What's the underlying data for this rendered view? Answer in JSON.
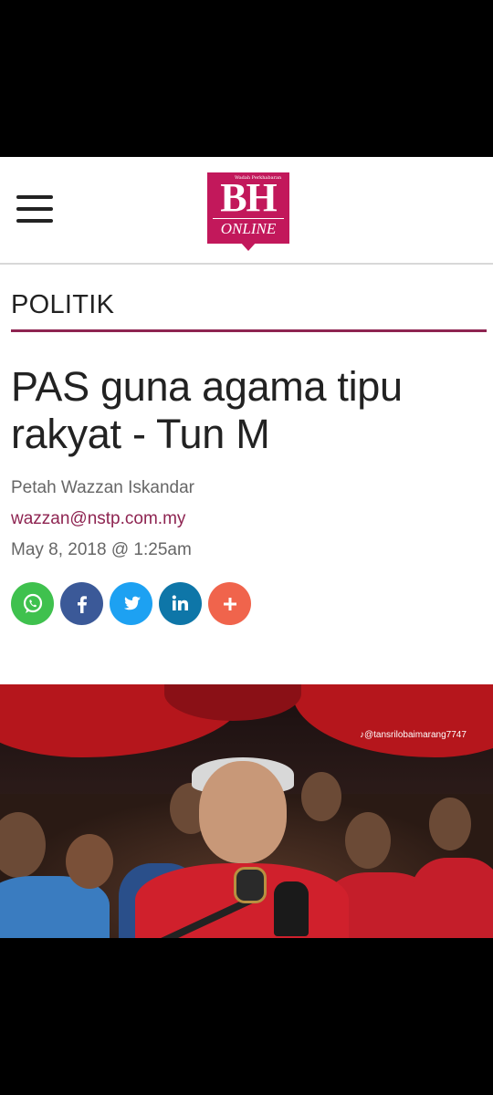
{
  "header": {
    "menu_icon": "hamburger-menu-icon",
    "logo": {
      "tagline": "Wadah Perkhabaran",
      "main": "BH",
      "sub": "ONLINE",
      "color": "#c2185b"
    }
  },
  "article": {
    "section": "POLITIK",
    "title": "PAS guna agama tipu rakyat - Tun M",
    "author": "Petah Wazzan Iskandar",
    "email": "wazzan@nstp.com.my",
    "date": "May 8, 2018 @ 1:25am",
    "accent_color": "#8e2451"
  },
  "share": [
    {
      "name": "whatsapp",
      "icon": "whatsapp-icon",
      "color": "#3fc14e"
    },
    {
      "name": "facebook",
      "icon": "facebook-icon",
      "color": "#3b5998"
    },
    {
      "name": "twitter",
      "icon": "twitter-icon",
      "color": "#1da1f2"
    },
    {
      "name": "linkedin",
      "icon": "linkedin-icon",
      "color": "#0e76a8"
    },
    {
      "name": "more",
      "icon": "plus-icon",
      "color": "#f0644c"
    }
  ],
  "photo": {
    "watermark": "@tansrilobaimarang7747"
  }
}
